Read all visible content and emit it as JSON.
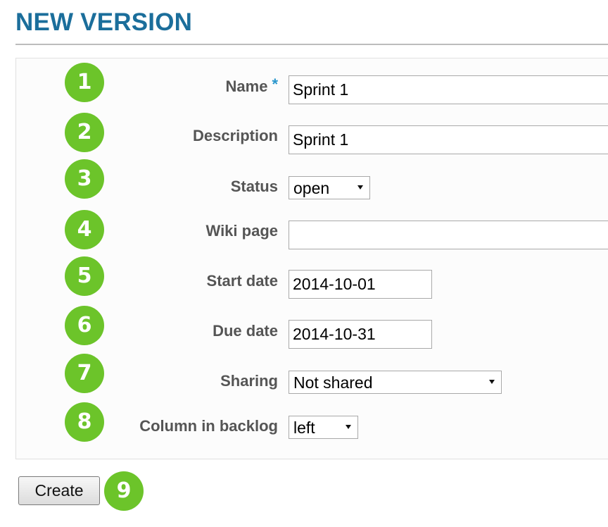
{
  "page": {
    "title": "NEW VERSION"
  },
  "form": {
    "name": {
      "label": "Name",
      "required_mark": "*",
      "value": "Sprint 1"
    },
    "description": {
      "label": "Description",
      "value": "Sprint 1"
    },
    "status": {
      "label": "Status",
      "selected": "open"
    },
    "wiki_page": {
      "label": "Wiki page",
      "value": ""
    },
    "start_date": {
      "label": "Start date",
      "value": "2014-10-01"
    },
    "due_date": {
      "label": "Due date",
      "value": "2014-10-31"
    },
    "sharing": {
      "label": "Sharing",
      "selected": "Not shared"
    },
    "column_in_backlog": {
      "label": "Column in backlog",
      "selected": "left"
    }
  },
  "actions": {
    "create_label": "Create"
  },
  "badges": [
    "1",
    "2",
    "3",
    "4",
    "5",
    "6",
    "7",
    "8",
    "9"
  ],
  "colors": {
    "title": "#1b6e9b",
    "badge": "#6cc42a",
    "label": "#555555",
    "required": "#2996cc"
  }
}
